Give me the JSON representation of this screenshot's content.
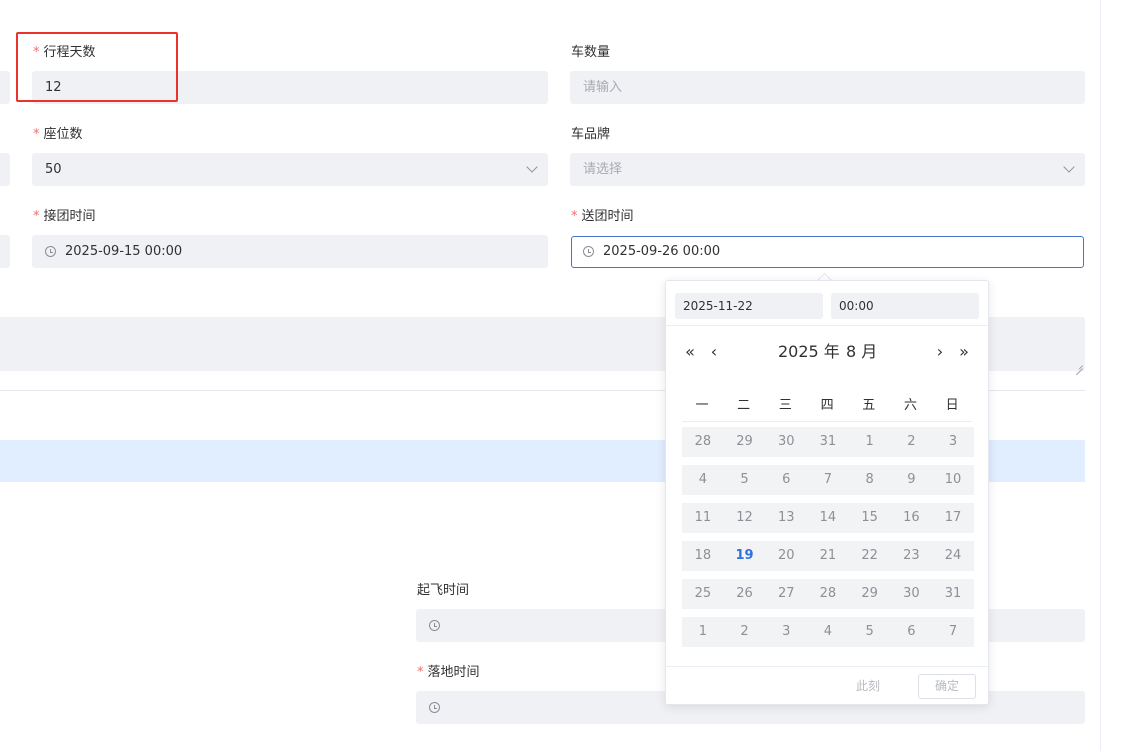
{
  "form": {
    "trip_days": {
      "label": "行程天数",
      "required": true,
      "value": "12"
    },
    "car_count": {
      "label": "车数量",
      "required": false,
      "placeholder": "请输入"
    },
    "seats": {
      "label": "座位数",
      "required": true,
      "value": "50"
    },
    "car_brand": {
      "label": "车品牌",
      "required": false,
      "placeholder": "请选择"
    },
    "pickup_time": {
      "label": "接团时间",
      "required": true,
      "value": "2025-09-15 00:00"
    },
    "dropoff_time": {
      "label": "送团时间",
      "required": true,
      "value": "2025-09-26 00:00"
    },
    "takeoff_time": {
      "label": "起飞时间",
      "required": false,
      "value": ""
    },
    "landing_time": {
      "label": "落地时间",
      "required": true,
      "value": ""
    },
    "required_mark": "*"
  },
  "picker": {
    "date_input": "2025-11-22",
    "time_input": "00:00",
    "year_label": "2025 年",
    "month_label": "8 月",
    "nav": {
      "prev_year": "«",
      "prev_month": "‹",
      "next_month": "›",
      "next_year": "»"
    },
    "weekdays": [
      "一",
      "二",
      "三",
      "四",
      "五",
      "六",
      "日"
    ],
    "weeks": [
      [
        "28",
        "29",
        "30",
        "31",
        "1",
        "2",
        "3"
      ],
      [
        "4",
        "5",
        "6",
        "7",
        "8",
        "9",
        "10"
      ],
      [
        "11",
        "12",
        "13",
        "14",
        "15",
        "16",
        "17"
      ],
      [
        "18",
        "19",
        "20",
        "21",
        "22",
        "23",
        "24"
      ],
      [
        "25",
        "26",
        "27",
        "28",
        "29",
        "30",
        "31"
      ],
      [
        "1",
        "2",
        "3",
        "4",
        "5",
        "6",
        "7"
      ]
    ],
    "today": "19",
    "now_label": "此刻",
    "confirm_label": "确定"
  },
  "colors": {
    "required": "#f56c6c",
    "highlight_box": "#e8342a",
    "today": "#2f6fe0",
    "active_border": "#4a72c4"
  }
}
